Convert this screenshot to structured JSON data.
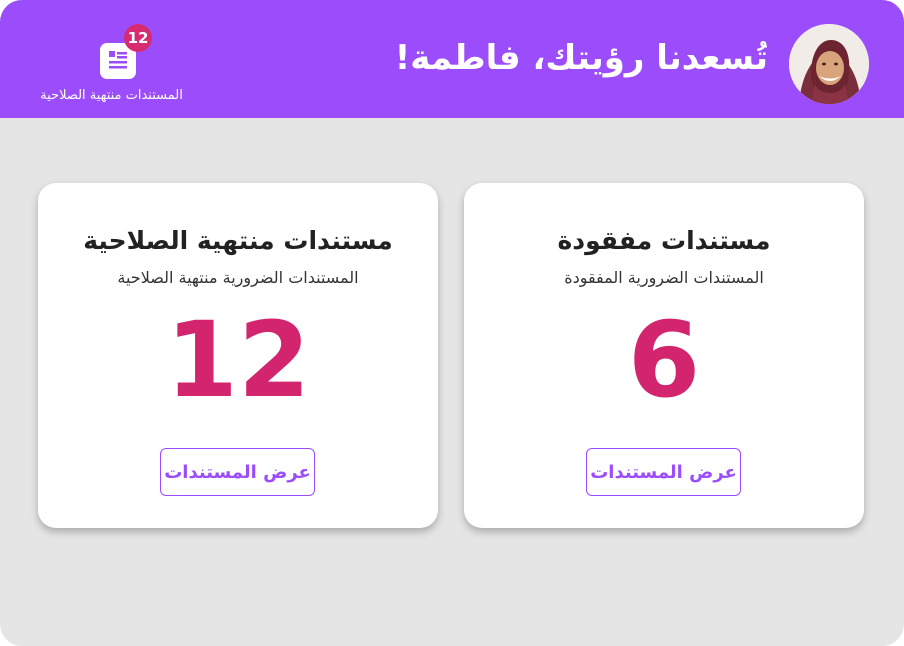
{
  "header": {
    "greeting": "تُسعدنا رؤيتك، فاطمة!",
    "notification": {
      "count": "12",
      "label": "المستندات منتهية الصلاحية",
      "icon": "document-icon"
    },
    "avatar": "user-avatar-photo"
  },
  "cards": [
    {
      "title": "مستندات مفقودة",
      "subtitle": "المستندات الضرورية المفقودة",
      "count": "6",
      "button_label": "عرض المستندات"
    },
    {
      "title": "مستندات منتهية الصلاحية",
      "subtitle": "المستندات الضرورية منتهية الصلاحية",
      "count": "12",
      "button_label": "عرض المستندات"
    }
  ],
  "colors": {
    "header": "#9b4dfb",
    "accent": "#d2256e",
    "badge": "#d62b6e",
    "background": "#e5e5e5"
  }
}
